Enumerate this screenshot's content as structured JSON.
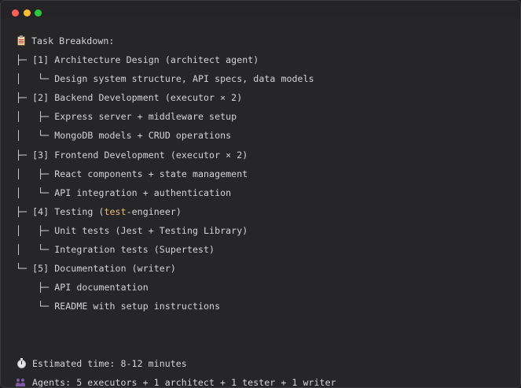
{
  "header": {
    "icon": "clipboard-icon",
    "title": "Task Breakdown:"
  },
  "tree": [
    {
      "prefix": "├─ ",
      "text": "[1] Architecture Design (architect agent)"
    },
    {
      "prefix": "│   └─ ",
      "text": "Design system structure, API specs, data models"
    },
    {
      "prefix": "├─ ",
      "text": "[2] Backend Development (executor × 2)"
    },
    {
      "prefix": "│   ├─ ",
      "text": "Express server + middleware setup"
    },
    {
      "prefix": "│   └─ ",
      "text": "MongoDB models + CRUD operations"
    },
    {
      "prefix": "├─ ",
      "text": "[3] Frontend Development (executor × 2)"
    },
    {
      "prefix": "│   ├─ ",
      "text": "React components + state management"
    },
    {
      "prefix": "│   └─ ",
      "text": "API integration + authentication"
    },
    {
      "prefix": "├─ ",
      "text_before": "[4] Testing (",
      "highlight": "test",
      "text_after": "-engineer)"
    },
    {
      "prefix": "│   ├─ ",
      "text": "Unit tests (Jest + Testing Library)"
    },
    {
      "prefix": "│   └─ ",
      "text": "Integration tests (Supertest)"
    },
    {
      "prefix": "└─ ",
      "text": "[5] Documentation (writer)"
    },
    {
      "prefix": "    ├─ ",
      "text": "API documentation"
    },
    {
      "prefix": "    └─ ",
      "text": "README with setup instructions"
    }
  ],
  "footer": {
    "time": {
      "icon": "stopwatch-icon",
      "text": "Estimated time: 8-12 minutes"
    },
    "agents": {
      "icon": "people-icon",
      "text": "Agents: 5 executors + 1 architect + 1 tester + 1 writer"
    }
  },
  "colors": {
    "background": "#262628",
    "text": "#d4d4d4",
    "highlight": "#e5c07b"
  }
}
